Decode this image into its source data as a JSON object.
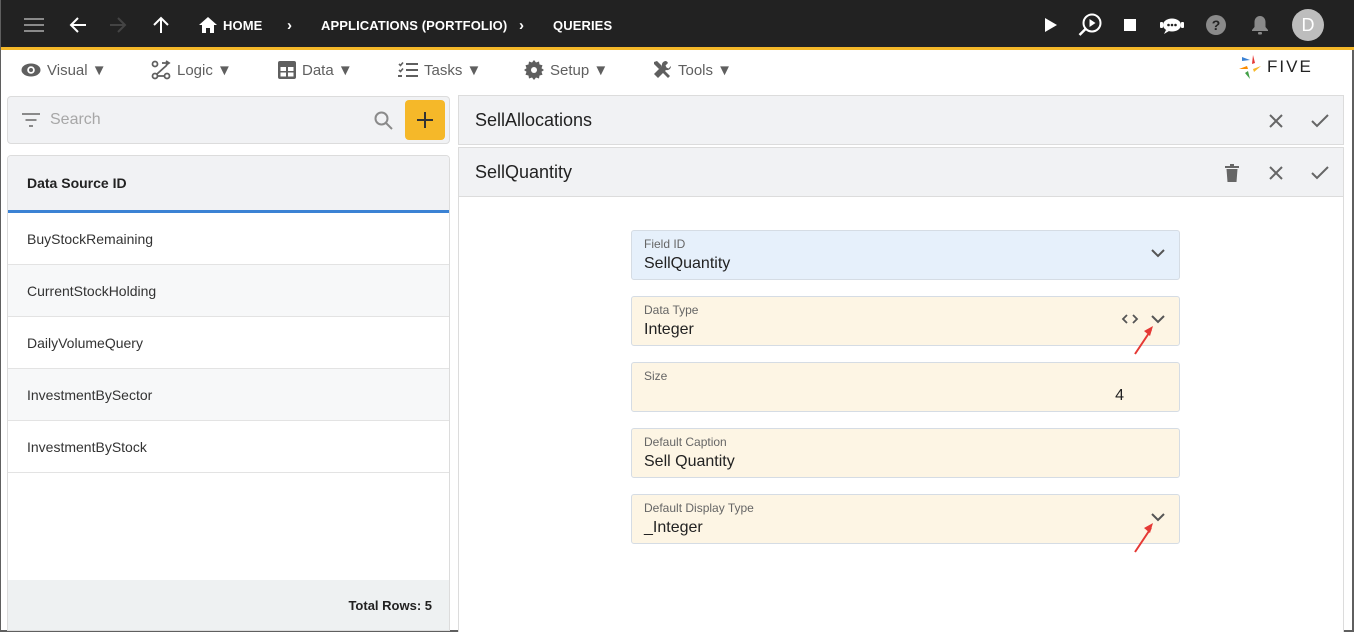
{
  "topbar": {
    "breadcrumbs": [
      {
        "label": "HOME",
        "icon": "home-icon"
      },
      {
        "label": "APPLICATIONS (PORTFOLIO)"
      },
      {
        "label": "QUERIES"
      }
    ],
    "avatar_initial": "D",
    "icons": [
      "menu-icon",
      "back-icon",
      "forward-icon",
      "up-icon",
      "run-icon",
      "debug-icon",
      "stop-icon",
      "chat-bot-icon",
      "help-icon",
      "notification-icon"
    ],
    "accent_color": "#f5b829"
  },
  "menubar": {
    "items": [
      {
        "label": "Visual ▼",
        "icon": "eye-icon"
      },
      {
        "label": "Logic ▼",
        "icon": "logic-icon"
      },
      {
        "label": "Data ▼",
        "icon": "table-icon"
      },
      {
        "label": "Tasks ▼",
        "icon": "tasks-icon"
      },
      {
        "label": "Setup ▼",
        "icon": "gear-icon"
      },
      {
        "label": "Tools ▼",
        "icon": "tools-icon"
      }
    ],
    "logo_text": "FIVE"
  },
  "left": {
    "search_placeholder": "Search",
    "column_header": "Data Source ID",
    "rows": [
      "BuyStockRemaining",
      "CurrentStockHolding",
      "DailyVolumeQuery",
      "InvestmentBySector",
      "InvestmentByStock"
    ],
    "footer": "Total Rows: 5"
  },
  "right": {
    "parent_title": "SellAllocations",
    "child_title": "SellQuantity",
    "fields": [
      {
        "label": "Field ID",
        "value": "SellQuantity"
      },
      {
        "label": "Data Type",
        "value": "Integer"
      },
      {
        "label": "Size",
        "value": "4"
      },
      {
        "label": "Default Caption",
        "value": "Sell Quantity"
      },
      {
        "label": "Default Display Type",
        "value": "_Integer"
      }
    ]
  }
}
